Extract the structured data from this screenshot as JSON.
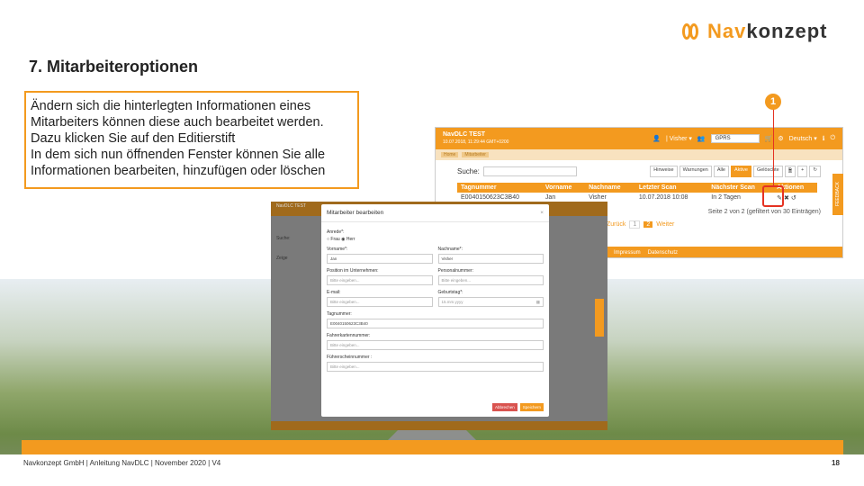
{
  "brand": {
    "logo_nav": "Nav",
    "logo_rest": "konzept"
  },
  "slide": {
    "title": "7. Mitarbeiteroptionen",
    "text_lines": [
      "Ändern sich die hinterlegten Informationen eines",
      "Mitarbeiters können diese auch bearbeitet werden.",
      "Dazu klicken Sie auf den Editierstift",
      "In dem sich nun öffnenden Fenster können Sie alle",
      "Informationen bearbeiten, hinzufügen oder löschen"
    ],
    "footer": "Navkonzept GmbH | Anleitung NavDLC | November 2020 | V4",
    "page": "18",
    "callout": "1"
  },
  "app": {
    "brand": "NavDLC TEST",
    "datetime": "10.07.2018, 11:29:44 GMT+0200",
    "user": "| Visher ▾",
    "gprs": "GPRS",
    "language": "Deutsch ▾",
    "breadcrumb": [
      "Home",
      "Mitarbeiter"
    ],
    "search_label": "Suche:",
    "filters": {
      "hinweise": "Hinweise",
      "warnungen": "Warnungen",
      "alle": "Alle",
      "aktive": "Aktive",
      "geloeschte": "Gelöschte"
    },
    "table": {
      "headers": [
        "Tagnummer",
        "Vorname",
        "Nachname",
        "Letzter Scan",
        "Nächster Scan",
        "Aktionen"
      ],
      "row": [
        "E0040150623C3B40",
        "Jan",
        "Visher",
        "10.07.2018 10:08",
        "In 2 Tagen"
      ]
    },
    "pagination_info": "Seite 2 von 2 (gefiltert von 30 Einträgen)",
    "prev": "Zurück",
    "pages": [
      "1",
      "2"
    ],
    "next": "Weiter",
    "footer_links": [
      "Impressum",
      "Datenschutz"
    ],
    "feedback": "FEEDBACK",
    "show": "Zeige"
  },
  "modal": {
    "title": "Mitarbeiter bearbeiten",
    "close": "×",
    "anrede": "Anrede*:",
    "frau": "Frau",
    "herr": "Herr",
    "vorname_lbl": "Vorname*:",
    "vorname_val": "Jan",
    "nachname_lbl": "Nachname*:",
    "nachname_val": "Visher",
    "position_lbl": "Position im Unternehmen:",
    "personal_lbl": "Personalnummer:",
    "email_lbl": "E-mail:",
    "geburtstag_lbl": "Geburtstag*:",
    "geburtstag_val": "15.mm.yyyy",
    "tag_lbl": "Tagnummer:",
    "tag_val": "E0040150623C3B40",
    "fahrer_lbl": "Fahrerkartennummer:",
    "fuehrer_lbl": "Führerscheinnummer :",
    "placeholder": "Bitte eingeben...",
    "cancel": "Abbrechen",
    "save": "Speichern"
  }
}
